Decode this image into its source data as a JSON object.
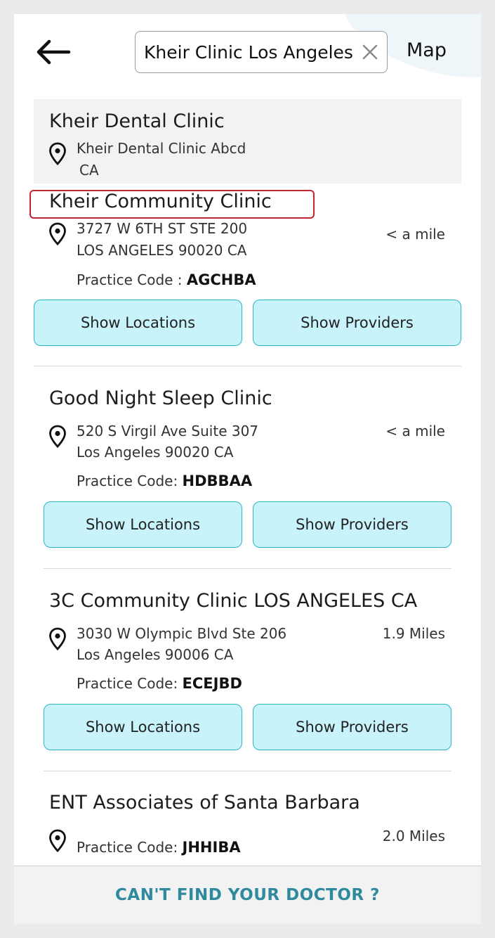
{
  "header": {
    "search_value": "Kheir Clinic Los Angeles",
    "map_label": "Map",
    "back_icon": "back-arrow-icon",
    "clear_icon": "close-icon"
  },
  "colors": {
    "button_fill": "#c9f3fb",
    "button_border": "#2eb6c7",
    "highlight": "#c0262d",
    "footer_text": "#2f8a9e"
  },
  "results": [
    {
      "name": "Kheir Dental Clinic",
      "address_line1": "Kheir Dental Clinic Abcd",
      "address_line2": "CA"
    },
    {
      "name": "Kheir Community Clinic",
      "address_line1": "3727 W 6TH ST STE 200",
      "address_line2": "LOS ANGELES 90020 CA",
      "distance": "< a mile",
      "practice_code_label": "Practice Code : ",
      "practice_code": "AGCHBA",
      "show_locations": "Show Locations",
      "show_providers": "Show Providers"
    },
    {
      "name": "Good Night Sleep Clinic",
      "address_line1": "520 S Virgil Ave Suite 307",
      "address_line2": "Los Angeles 90020 CA",
      "distance": "< a mile",
      "practice_code_label": "Practice Code: ",
      "practice_code": "HDBBAA",
      "show_locations": "Show Locations",
      "show_providers": "Show Providers"
    },
    {
      "name": "3C Community Clinic LOS ANGELES CA",
      "address_line1": "3030 W Olympic Blvd Ste 206",
      "address_line2": "Los Angeles 90006 CA",
      "distance": "1.9 Miles",
      "practice_code_label": "Practice Code: ",
      "practice_code": "ECEJBD",
      "show_locations": "Show Locations",
      "show_providers": "Show Providers"
    },
    {
      "name": "ENT Associates of Santa Barbara",
      "distance": "2.0 Miles",
      "practice_code_label": "Practice Code: ",
      "practice_code": "JHHIBA"
    }
  ],
  "footer": {
    "cta_label": "CAN'T FIND YOUR DOCTOR ?"
  }
}
